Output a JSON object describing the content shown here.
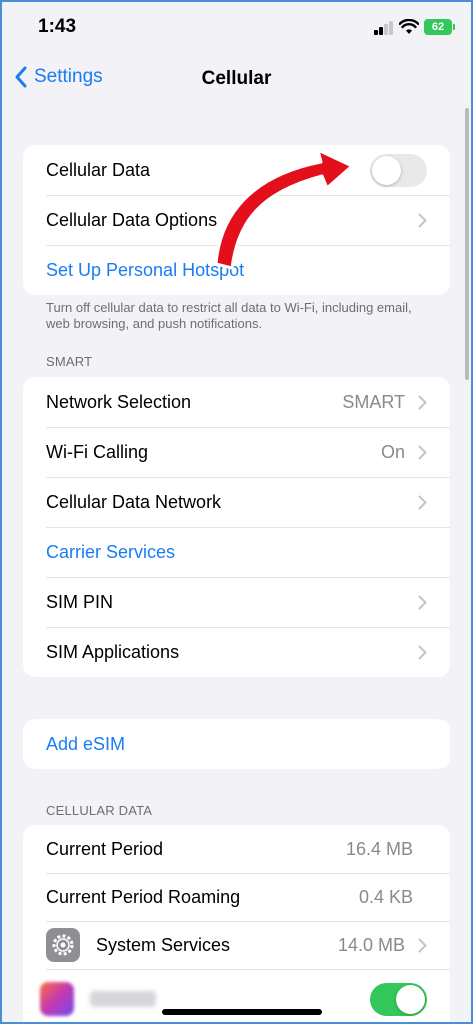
{
  "status_bar": {
    "time": "1:43",
    "battery": "62"
  },
  "nav": {
    "back_label": "Settings",
    "title": "Cellular"
  },
  "group1": {
    "cellular_data": "Cellular Data",
    "cellular_data_options": "Cellular Data Options",
    "personal_hotspot": "Set Up Personal Hotspot",
    "footer": "Turn off cellular data to restrict all data to Wi-Fi, including email, web browsing, and push notifications."
  },
  "smart": {
    "header": "SMART",
    "rows": [
      {
        "label": "Network Selection",
        "value": "SMART"
      },
      {
        "label": "Wi-Fi Calling",
        "value": "On"
      },
      {
        "label": "Cellular Data Network",
        "value": ""
      },
      {
        "label": "Carrier Services",
        "value": ""
      },
      {
        "label": "SIM PIN",
        "value": ""
      },
      {
        "label": "SIM Applications",
        "value": ""
      }
    ]
  },
  "esim": {
    "label": "Add eSIM"
  },
  "cellular_data": {
    "header": "CELLULAR DATA",
    "rows": [
      {
        "label": "Current Period",
        "value": "16.4 MB"
      },
      {
        "label": "Current Period Roaming",
        "value": "0.4 KB"
      },
      {
        "label": "System Services",
        "value": "14.0 MB"
      }
    ]
  },
  "toggles": {
    "cellular_data_on": false,
    "app_on": true
  },
  "colors": {
    "accent": "#1a7cf5",
    "toggle_on": "#34c759",
    "annotation_arrow": "#e3101b"
  }
}
